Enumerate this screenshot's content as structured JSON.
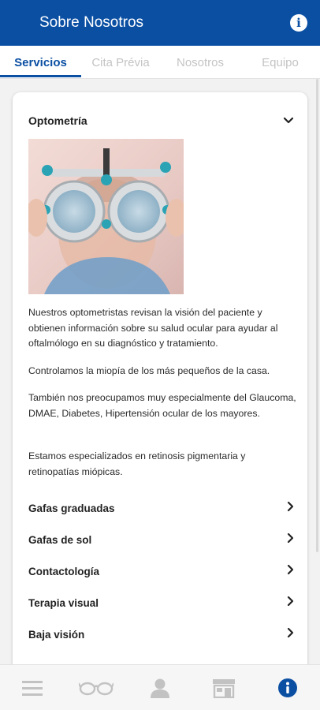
{
  "header": {
    "title": "Sobre Nosotros",
    "info_icon": "info-icon"
  },
  "tabs": [
    {
      "label": "Servicios",
      "active": true
    },
    {
      "label": "Cita Prévia",
      "active": false
    },
    {
      "label": "Nosotros",
      "active": false
    },
    {
      "label": "Equipo",
      "active": false
    }
  ],
  "section": {
    "title": "Optometría",
    "expanded_icon": "chevron-down-icon",
    "image": "optometry-trial-frame-photo",
    "paragraphs": [
      "Nuestros optometristas revisan la visión del paciente y obtienen información sobre su salud ocular para ayudar al oftalmólogo en su diagnóstico y tratamiento.",
      "Controlamos la miopía de los más pequeños de la casa.",
      "También nos preocupamos muy especialmente del Glaucoma, DMAE, Diabetes, Hipertensión ocular de los mayores.",
      "Estamos especializados en retinosis pigmentaria y retinopatías miópicas."
    ]
  },
  "services": [
    {
      "label": "Gafas graduadas"
    },
    {
      "label": "Gafas de sol"
    },
    {
      "label": "Contactología"
    },
    {
      "label": "Terapia visual"
    },
    {
      "label": "Baja visión"
    }
  ],
  "bottom_nav": [
    {
      "icon": "menu-icon",
      "active": false
    },
    {
      "icon": "glasses-icon",
      "active": false
    },
    {
      "icon": "person-icon",
      "active": false
    },
    {
      "icon": "store-icon",
      "active": false
    },
    {
      "icon": "info-icon",
      "active": true
    }
  ],
  "colors": {
    "primary": "#0b4fa3",
    "inactive_tab": "#c4c4c4",
    "nav_inactive": "#c2c2c2"
  }
}
